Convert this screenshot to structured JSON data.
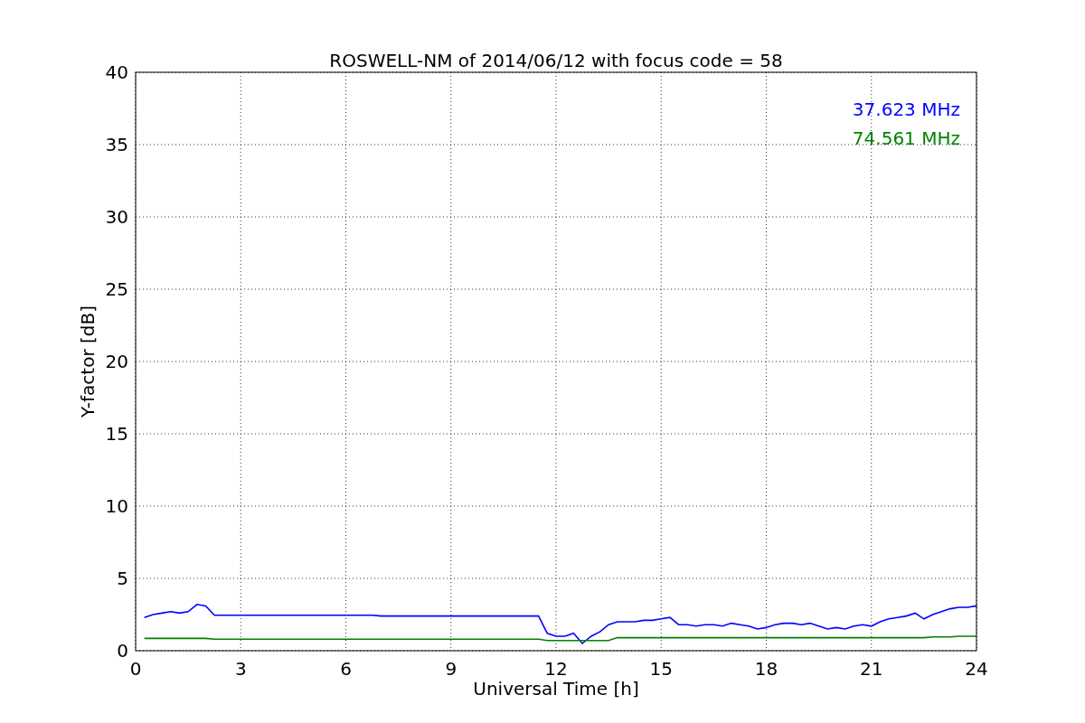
{
  "figure": {
    "chart_data": {
      "type": "line",
      "title": "ROSWELL-NM of 2014/06/12 with focus code = 58",
      "xlabel": "Universal Time [h]",
      "ylabel": "Y-factor [dB]",
      "x": [
        0.25,
        0.5,
        0.75,
        1,
        1.25,
        1.5,
        1.75,
        2,
        2.25,
        2.5,
        2.75,
        3,
        3.25,
        3.5,
        3.75,
        4,
        4.25,
        4.5,
        4.75,
        5,
        5.25,
        5.5,
        5.75,
        6,
        6.25,
        6.5,
        6.75,
        7,
        7.25,
        7.5,
        7.75,
        8,
        8.25,
        8.5,
        8.75,
        9,
        9.25,
        9.5,
        9.75,
        10,
        10.25,
        10.5,
        10.75,
        11,
        11.25,
        11.5,
        11.75,
        12,
        12.25,
        12.5,
        12.75,
        13,
        13.25,
        13.5,
        13.75,
        14,
        14.25,
        14.5,
        14.75,
        15,
        15.25,
        15.5,
        15.75,
        16,
        16.25,
        16.5,
        16.75,
        17,
        17.25,
        17.5,
        17.75,
        18,
        18.25,
        18.5,
        18.75,
        19,
        19.25,
        19.5,
        19.75,
        20,
        20.25,
        20.5,
        20.75,
        21,
        21.25,
        21.5,
        21.75,
        22,
        22.25,
        22.5,
        22.75,
        23,
        23.25,
        23.5,
        23.75,
        24
      ],
      "series": [
        {
          "name": "37.623 MHz",
          "color": "#0000ff",
          "values": [
            2.3,
            2.5,
            2.6,
            2.7,
            2.6,
            2.7,
            3.2,
            3.1,
            2.45,
            2.45,
            2.45,
            2.45,
            2.45,
            2.45,
            2.45,
            2.45,
            2.45,
            2.45,
            2.45,
            2.45,
            2.45,
            2.45,
            2.45,
            2.45,
            2.45,
            2.45,
            2.45,
            2.4,
            2.4,
            2.4,
            2.4,
            2.4,
            2.4,
            2.4,
            2.4,
            2.4,
            2.4,
            2.4,
            2.4,
            2.4,
            2.4,
            2.4,
            2.4,
            2.4,
            2.4,
            2.4,
            1.2,
            1.0,
            1.0,
            1.2,
            0.5,
            1.0,
            1.3,
            1.8,
            2.0,
            2.0,
            2.0,
            2.1,
            2.1,
            2.2,
            2.3,
            1.8,
            1.8,
            1.7,
            1.8,
            1.8,
            1.7,
            1.9,
            1.8,
            1.7,
            1.5,
            1.6,
            1.8,
            1.9,
            1.9,
            1.8,
            1.9,
            1.7,
            1.5,
            1.6,
            1.5,
            1.7,
            1.8,
            1.7,
            2.0,
            2.2,
            2.3,
            2.4,
            2.6,
            2.2,
            2.5,
            2.7,
            2.9,
            3.0,
            3.0,
            3.1
          ]
        },
        {
          "name": "74.561 MHz",
          "color": "#008000",
          "values": [
            0.85,
            0.85,
            0.85,
            0.85,
            0.85,
            0.85,
            0.85,
            0.85,
            0.8,
            0.8,
            0.8,
            0.8,
            0.8,
            0.8,
            0.8,
            0.8,
            0.8,
            0.8,
            0.8,
            0.8,
            0.8,
            0.8,
            0.8,
            0.8,
            0.8,
            0.8,
            0.8,
            0.8,
            0.8,
            0.8,
            0.8,
            0.8,
            0.8,
            0.8,
            0.8,
            0.8,
            0.8,
            0.8,
            0.8,
            0.8,
            0.8,
            0.8,
            0.8,
            0.8,
            0.8,
            0.8,
            0.7,
            0.7,
            0.7,
            0.7,
            0.7,
            0.7,
            0.7,
            0.7,
            0.9,
            0.9,
            0.9,
            0.9,
            0.9,
            0.9,
            0.9,
            0.9,
            0.9,
            0.9,
            0.9,
            0.9,
            0.9,
            0.9,
            0.9,
            0.9,
            0.9,
            0.9,
            0.9,
            0.9,
            0.9,
            0.9,
            0.9,
            0.9,
            0.9,
            0.9,
            0.9,
            0.9,
            0.9,
            0.9,
            0.9,
            0.9,
            0.9,
            0.9,
            0.9,
            0.9,
            0.95,
            0.95,
            0.95,
            1.0,
            1.0,
            1.0
          ]
        }
      ],
      "xlim": [
        0,
        24
      ],
      "ylim": [
        0,
        40
      ],
      "xticks": [
        0,
        3,
        6,
        9,
        12,
        15,
        18,
        21,
        24
      ],
      "yticks": [
        0,
        5,
        10,
        15,
        20,
        25,
        30,
        35,
        40
      ],
      "grid": true
    }
  }
}
